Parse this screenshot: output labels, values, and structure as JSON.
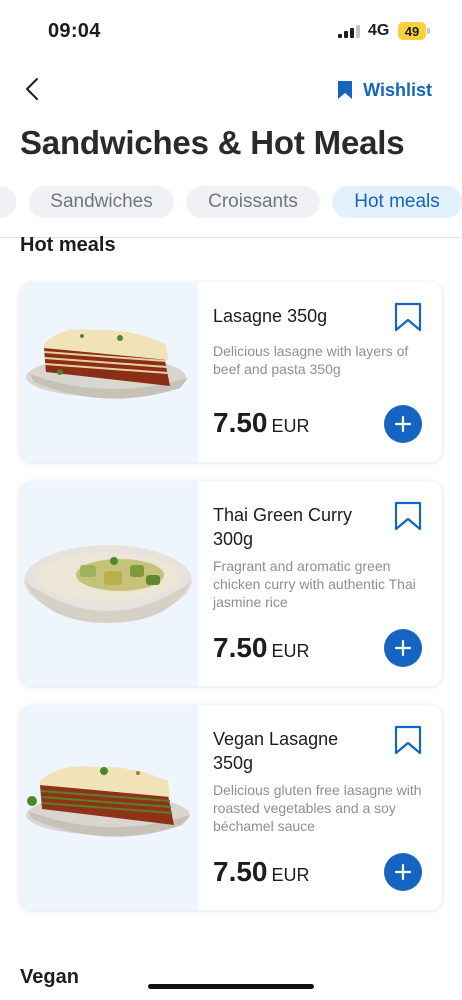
{
  "status_bar": {
    "time": "09:04",
    "network": "4G",
    "battery": "49"
  },
  "header": {
    "wishlist_label": "Wishlist",
    "title": "Sandwiches & Hot Meals"
  },
  "tabs": [
    {
      "label": ""
    },
    {
      "label": "Sandwiches"
    },
    {
      "label": "Croissants"
    },
    {
      "label": "Hot meals",
      "active": true
    }
  ],
  "sections": {
    "hot_meals": "Hot meals",
    "vegan": "Vegan"
  },
  "products": [
    {
      "name": "Lasagne 350g",
      "description": "Delicious lasagne with layers of beef and pasta 350g",
      "price": "7.50",
      "currency": "EUR",
      "image_icon": "lasagne-image"
    },
    {
      "name": "Thai Green Curry 300g",
      "description": "Fragrant and aromatic green chicken curry with authentic Thai jasmine rice",
      "price": "7.50",
      "currency": "EUR",
      "image_icon": "curry-bowl-image"
    },
    {
      "name": "Vegan Lasagne 350g",
      "description": "Delicious gluten free lasagne with roasted vegetables and a soy béchamel sauce",
      "price": "7.50",
      "currency": "EUR",
      "image_icon": "lasagne-image"
    }
  ],
  "colors": {
    "accent": "#1565c0",
    "chip_active_bg": "#e3f0fd",
    "image_bg": "#eef5fd",
    "battery": "#f7d13e"
  }
}
